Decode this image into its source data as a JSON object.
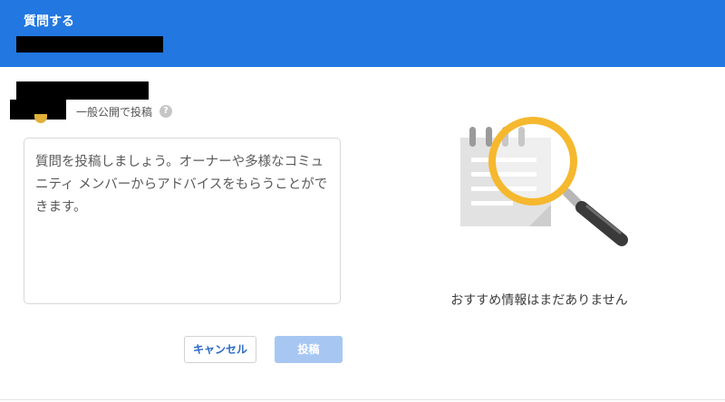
{
  "header": {
    "title": "質問する"
  },
  "composer": {
    "visibility_label": "一般公開で投稿",
    "help_glyph": "?",
    "placeholder": "質問を投稿しましょう。オーナーや多様なコミュニティ メンバーからアドバイスをもらうことができます。",
    "value": ""
  },
  "actions": {
    "cancel_label": "キャンセル",
    "post_label": "投稿"
  },
  "recommendations": {
    "empty_message": "おすすめ情報はまだありません",
    "illustration_icon": "magnifier-over-notepad-icon"
  },
  "colors": {
    "header_bg": "#2277e0",
    "accent_text": "#2b69c6",
    "post_button_disabled": "#a7c7f2",
    "magnifier_ring": "#f5b82e"
  }
}
